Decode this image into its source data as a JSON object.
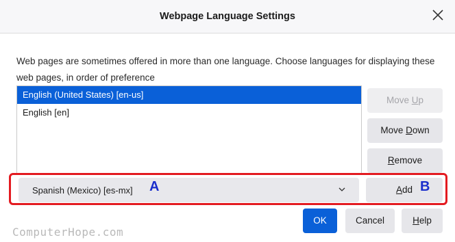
{
  "dialog": {
    "title": "Webpage Language Settings",
    "description": "Web pages are sometimes offered in more than one language. Choose languages for displaying these web pages, in order of preference"
  },
  "languages": [
    {
      "label": "English (United States) [en-us]",
      "selected": true
    },
    {
      "label": "English [en]",
      "selected": false
    }
  ],
  "buttons": {
    "move_up": {
      "pre": "Move ",
      "accel": "U",
      "post": "p",
      "disabled": true
    },
    "move_down": {
      "pre": "Move ",
      "accel": "D",
      "post": "own"
    },
    "remove": {
      "pre": "",
      "accel": "R",
      "post": "emove"
    },
    "add": {
      "pre": "",
      "accel": "A",
      "post": "dd"
    },
    "ok": "OK",
    "cancel": "Cancel",
    "help": {
      "pre": "",
      "accel": "H",
      "post": "elp"
    }
  },
  "language_select": {
    "value": "Spanish (Mexico) [es-mx]"
  },
  "annotations": {
    "a": "A",
    "b": "B"
  },
  "footer": {
    "logo_text": "ComputerHope.com"
  },
  "colors": {
    "accent": "#0a60d8",
    "highlight": "#e31a20",
    "marker": "#1a2ecc"
  }
}
